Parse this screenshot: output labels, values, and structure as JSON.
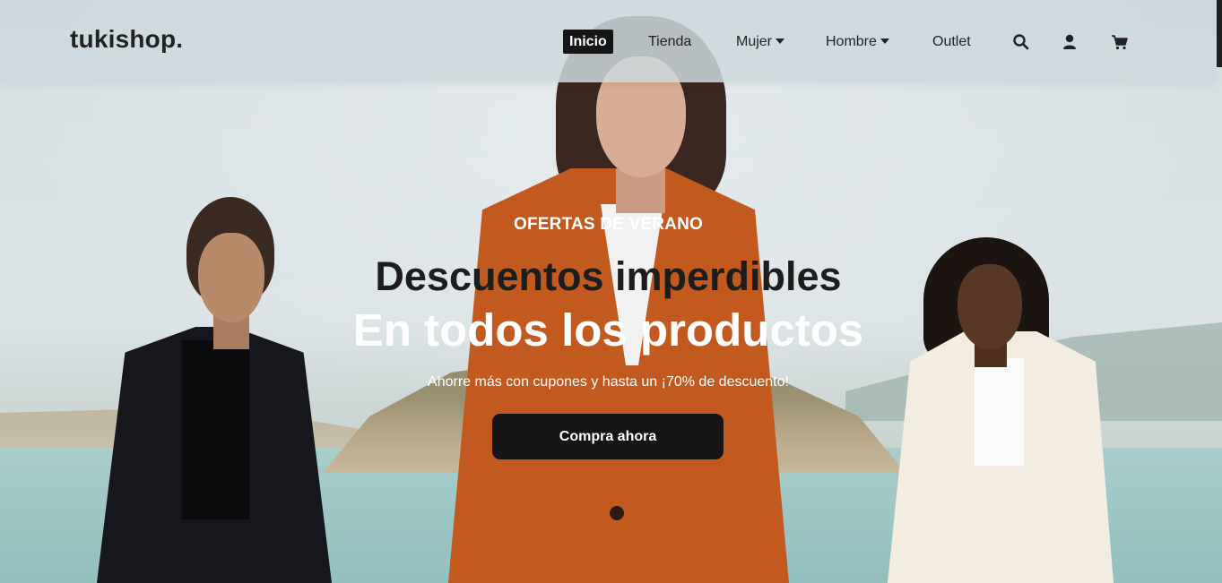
{
  "header": {
    "logo": "tukishop.",
    "nav": {
      "inicio": "Inicio",
      "tienda": "Tienda",
      "mujer": "Mujer",
      "hombre": "Hombre",
      "outlet": "Outlet"
    },
    "icons": [
      "search-icon",
      "user-icon",
      "cart-icon"
    ]
  },
  "hero": {
    "kicker": "OFERTAS DE VERANO",
    "headline_1": "Descuentos imperdibles",
    "headline_2": "En todos los productos",
    "subtitle": "Ahorre más con cupones y hasta un ¡70% de descuento!",
    "cta": "Compra ahora"
  },
  "colors": {
    "dark": "#151515",
    "text": "#222222",
    "white": "#ffffff"
  }
}
